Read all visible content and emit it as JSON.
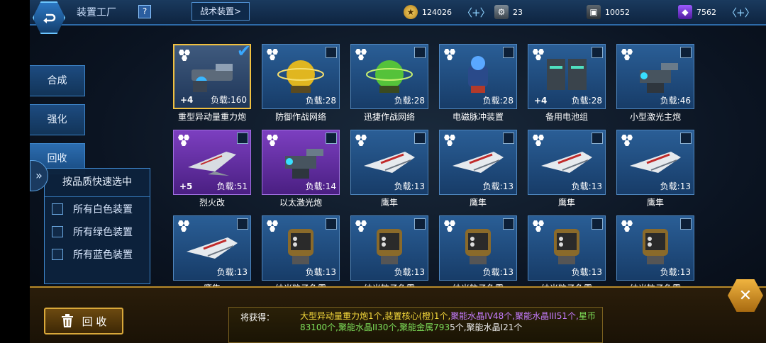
{
  "header": {
    "title": "装置工厂",
    "help_label": "?",
    "tactical_button": "战术装置>"
  },
  "resources": [
    {
      "icon": "gold-coin-icon",
      "value": "124026",
      "plus": "〈+〉"
    },
    {
      "icon": "gear-parts-icon",
      "value": "23"
    },
    {
      "icon": "metal-box-icon",
      "value": "10052"
    },
    {
      "icon": "crystal-icon",
      "value": "7562",
      "plus": "〈+〉"
    }
  ],
  "side_menu": [
    "合成",
    "强化",
    "回收"
  ],
  "quick_select": {
    "title": "按品质快速选中",
    "options": [
      "所有白色装置",
      "所有绿色装置",
      "所有蓝色装置"
    ]
  },
  "items": [
    {
      "name": "重型异动量重力炮",
      "bonus": "+4",
      "load": "负载:160",
      "selected": true,
      "frame": "gold"
    },
    {
      "name": "防御作战网络",
      "bonus": "",
      "load": "负载:28",
      "frame": "blue"
    },
    {
      "name": "迅捷作战网络",
      "bonus": "",
      "load": "负载:28",
      "frame": "blue"
    },
    {
      "name": "电磁脉冲装置",
      "bonus": "",
      "load": "负载:28",
      "frame": "blue"
    },
    {
      "name": "备用电池组",
      "bonus": "+4",
      "load": "负载:28",
      "frame": "blue"
    },
    {
      "name": "小型激光主炮",
      "bonus": "",
      "load": "负载:46",
      "frame": "blue"
    },
    {
      "name": "烈火改",
      "bonus": "+5",
      "load": "负载:51",
      "frame": "purple"
    },
    {
      "name": "以太激光炮",
      "bonus": "",
      "load": "负载:14",
      "frame": "purple"
    },
    {
      "name": "鹰隼",
      "bonus": "",
      "load": "负载:13",
      "frame": "blue"
    },
    {
      "name": "鹰隼",
      "bonus": "",
      "load": "负载:13",
      "frame": "blue"
    },
    {
      "name": "鹰隼",
      "bonus": "",
      "load": "负载:13",
      "frame": "blue"
    },
    {
      "name": "鹰隼",
      "bonus": "",
      "load": "负载:13",
      "frame": "blue"
    },
    {
      "name": "鹰隼",
      "bonus": "",
      "load": "负载:13",
      "frame": "blue"
    },
    {
      "name": "纳米粒子鱼雷",
      "bonus": "",
      "load": "负载:13",
      "frame": "blue"
    },
    {
      "name": "纳米粒子鱼雷",
      "bonus": "",
      "load": "负载:13",
      "frame": "blue"
    },
    {
      "name": "纳米粒子鱼雷",
      "bonus": "",
      "load": "负载:13",
      "frame": "blue"
    },
    {
      "name": "纳米粒子鱼雷",
      "bonus": "",
      "load": "负载:13",
      "frame": "blue"
    },
    {
      "name": "纳米粒子鱼雷",
      "bonus": "",
      "load": "负载:13",
      "frame": "blue"
    }
  ],
  "recycle": {
    "button_label": "回 收",
    "gain_label": "将获得：",
    "gain_segments": [
      {
        "text": "大型异动量重力炮1个,",
        "color": "yellow"
      },
      {
        "text": "装置核心(橙)1个,",
        "color": "yellow"
      },
      {
        "text": "聚能水晶IV48个,",
        "color": "purple"
      },
      {
        "text": "聚能水晶III51个,",
        "color": "purple"
      },
      {
        "text": "星币83100个,",
        "color": "green"
      },
      {
        "text": "聚能水晶II30个,",
        "color": "green"
      },
      {
        "text": "聚能金属793",
        "color": "green"
      },
      {
        "text": "5个,聚能水晶I21个",
        "color": "white"
      }
    ]
  },
  "colors": {
    "gold_frame": "#f0c040",
    "purple_frame": "#7c3fc0",
    "blue_frame": "#2a5e96",
    "selected_check": "#39a8ff"
  }
}
